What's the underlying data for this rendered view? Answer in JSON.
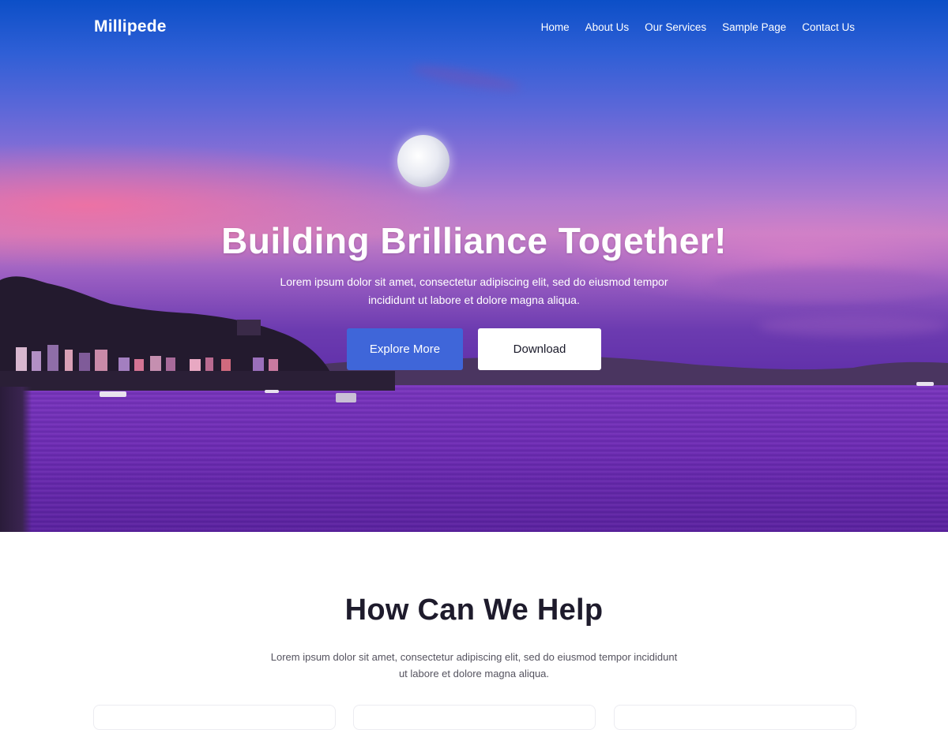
{
  "header": {
    "logo": "Millipede",
    "nav": [
      "Home",
      "About Us",
      "Our Services",
      "Sample Page",
      "Contact Us"
    ]
  },
  "hero": {
    "title": "Building Brilliance Together!",
    "subtitle_line1": "Lorem ipsum dolor sit amet, consectetur adipiscing elit, sed do eiusmod tempor",
    "subtitle_line2": "incididunt ut labore et dolore magna aliqua.",
    "primary_button": "Explore More",
    "secondary_button": "Download"
  },
  "help": {
    "title": "How Can We Help",
    "subtitle_line1": "Lorem ipsum dolor sit amet, consectetur adipiscing elit, sed do eiusmod tempor incididunt",
    "subtitle_line2": "ut labore et dolore magna aliqua."
  },
  "colors": {
    "primary_button": "#3f66d9",
    "heading_dark": "#1e1b2c",
    "body_text": "#55535f"
  }
}
